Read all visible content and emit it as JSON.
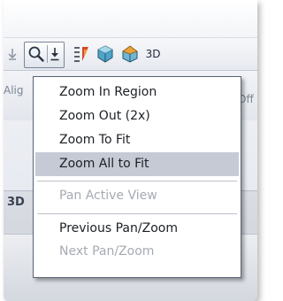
{
  "toolbar": {
    "buttons": [
      {
        "icon": "zoom-magnifier-icon",
        "state": "pressed"
      },
      {
        "icon": "dropdown-arrow-icon"
      },
      {
        "icon": "layers-icon"
      },
      {
        "icon": "3d-cube-icon"
      },
      {
        "icon": "3d-house-icon"
      }
    ],
    "label_3d": "3D"
  },
  "background": {
    "left_partial_text": "Alig",
    "right_partial_text": "Off",
    "lower_label": "3D"
  },
  "menu": {
    "items": [
      {
        "label": "Zoom In Region",
        "enabled": true,
        "selected": false
      },
      {
        "label": "Zoom Out (2x)",
        "enabled": true,
        "selected": false
      },
      {
        "label": "Zoom To Fit",
        "enabled": true,
        "selected": false
      },
      {
        "label": "Zoom All to Fit",
        "enabled": true,
        "selected": true
      },
      {
        "label": "Pan Active View",
        "enabled": false,
        "selected": false
      },
      {
        "label": "Previous Pan/Zoom",
        "enabled": true,
        "selected": false
      },
      {
        "label": "Next Pan/Zoom",
        "enabled": false,
        "selected": false
      }
    ]
  },
  "colors": {
    "highlight": "#c5cad5",
    "disabled_text": "#a5aab3",
    "text": "#1c1f24"
  }
}
